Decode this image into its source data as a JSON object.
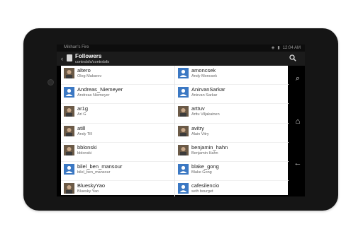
{
  "status": {
    "carrier": "Mikhan's Fire",
    "time": "12:04 AM"
  },
  "actionbar": {
    "title": "Followers",
    "subtitle": "contrslsfs/contrslsfs"
  },
  "list": {
    "left": [
      {
        "username": "altero",
        "realname": "Oleg Makarov",
        "avatar": "photo"
      },
      {
        "username": "Andreas_Niemeyer",
        "realname": "Andreas Niemeyer",
        "avatar": "default"
      },
      {
        "username": "ar1g",
        "realname": "Ari G",
        "avatar": "photo"
      },
      {
        "username": "atill",
        "realname": "Andy Till",
        "avatar": "photo"
      },
      {
        "username": "bblonski",
        "realname": "bblonski",
        "avatar": "photo"
      },
      {
        "username": "bilel_ben_mansour",
        "realname": "bilel_ben_mansour",
        "avatar": "default"
      },
      {
        "username": "BlueskyYao",
        "realname": "Bluesky Yao",
        "avatar": "photo"
      }
    ],
    "right": [
      {
        "username": "amoncsek",
        "realname": "Andy Moncsek",
        "avatar": "default"
      },
      {
        "username": "AnirvanSarkar",
        "realname": "Anirvan Sarkar",
        "avatar": "default"
      },
      {
        "username": "arttuv",
        "realname": "Arttu Viljakainen",
        "avatar": "photo"
      },
      {
        "username": "avitry",
        "realname": "Alain Vitry",
        "avatar": "photo"
      },
      {
        "username": "benjamin_hahn",
        "realname": "Benjamin Hahn",
        "avatar": "photo"
      },
      {
        "username": "blake_gong",
        "realname": "Blake Gong",
        "avatar": "default"
      },
      {
        "username": "cafesilencio",
        "realname": "seth bourget",
        "avatar": "default"
      }
    ]
  },
  "colors": {
    "accent": "#3b78c3",
    "bezel": "#151515"
  },
  "icons": {
    "search": "search-icon",
    "home": "home-icon",
    "back": "back-arrow-icon"
  }
}
